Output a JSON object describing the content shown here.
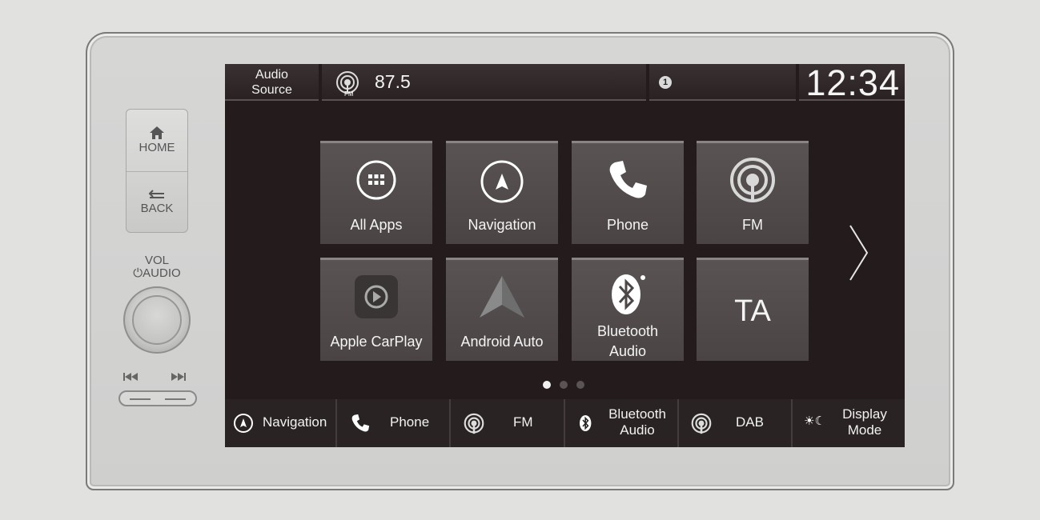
{
  "hardware": {
    "home_label": "HOME",
    "back_label": "BACK",
    "vol_label": "VOL",
    "audio_label": "AUDIO"
  },
  "topbar": {
    "audio_source_line1": "Audio",
    "audio_source_line2": "Source",
    "fm_badge": "FM",
    "frequency": "87.5",
    "notification_count": "1",
    "clock": "12:34"
  },
  "apps": [
    {
      "label": "All Apps",
      "icon": "grid-icon"
    },
    {
      "label": "Navigation",
      "icon": "compass-icon"
    },
    {
      "label": "Phone",
      "icon": "phone-icon"
    },
    {
      "label": "FM",
      "icon": "radio-icon"
    },
    {
      "label": "Apple CarPlay",
      "icon": "carplay-icon"
    },
    {
      "label": "Android Auto",
      "icon": "android-auto-icon"
    },
    {
      "label_line1": "Bluetooth",
      "label_line2": "Audio",
      "icon": "bluetooth-icon"
    },
    {
      "label": "TA",
      "icon": "none"
    }
  ],
  "pager": {
    "pages": 3,
    "current": 1
  },
  "shortcuts": [
    {
      "label": "Navigation",
      "icon": "compass-icon"
    },
    {
      "label": "Phone",
      "icon": "phone-icon"
    },
    {
      "label": "FM",
      "icon": "radio-icon"
    },
    {
      "label_line1": "Bluetooth",
      "label_line2": "Audio",
      "icon": "bluetooth-icon"
    },
    {
      "label": "DAB",
      "icon": "radio-icon"
    },
    {
      "label_line1": "Display",
      "label_line2": "Mode",
      "icon": "day-night-icon"
    }
  ],
  "colors": {
    "screen_bg": "#241c1c",
    "tile_bg": "#524c4c",
    "bezel": "#d3d3d2"
  }
}
